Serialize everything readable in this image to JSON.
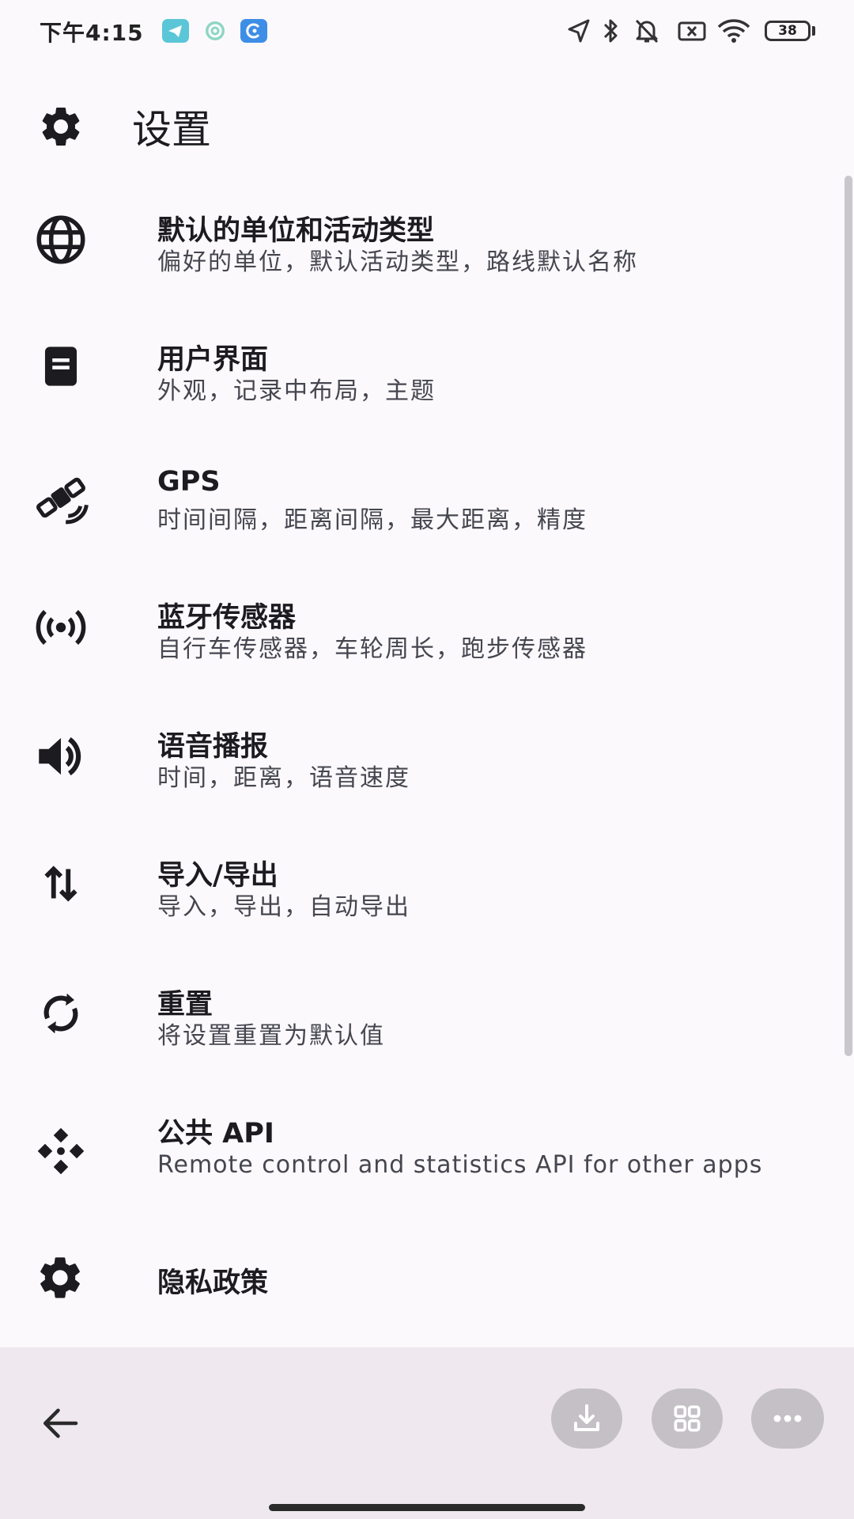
{
  "status_bar": {
    "time": "下午4:15",
    "battery": "38"
  },
  "app_bar": {
    "title": "设置",
    "icon": "gear-icon"
  },
  "settings": [
    {
      "icon": "globe-icon",
      "title": "默认的单位和活动类型",
      "subtitle": "偏好的单位，默认活动类型，路线默认名称"
    },
    {
      "icon": "document-icon",
      "title": "用户界面",
      "subtitle": "外观，记录中布局，主题"
    },
    {
      "icon": "satellite-icon",
      "title": "GPS",
      "subtitle": "时间间隔，距离间隔，最大距离，精度"
    },
    {
      "icon": "sensor-broadcast-icon",
      "title": "蓝牙传感器",
      "subtitle": "自行车传感器，车轮周长，跑步传感器"
    },
    {
      "icon": "volume-icon",
      "title": "语音播报",
      "subtitle": "时间，距离，语音速度"
    },
    {
      "icon": "import-export-icon",
      "title": "导入/导出",
      "subtitle": "导入，导出，自动导出"
    },
    {
      "icon": "reset-icon",
      "title": "重置",
      "subtitle": "将设置重置为默认值"
    },
    {
      "icon": "api-icon",
      "title": "公共 API",
      "subtitle": "Remote control and statistics API for other apps"
    },
    {
      "icon": "gear-icon",
      "title": "隐私政策",
      "subtitle": ""
    }
  ],
  "bottom_bar": {
    "back": "back-arrow-icon",
    "actions": [
      "download-icon",
      "grid-icon",
      "more-icon"
    ]
  },
  "colors": {
    "background": "#fcf9fc",
    "bottom_bar": "#efe9ef",
    "pill_button": "#c4c0c6",
    "subtitle_text": "#45464f"
  }
}
